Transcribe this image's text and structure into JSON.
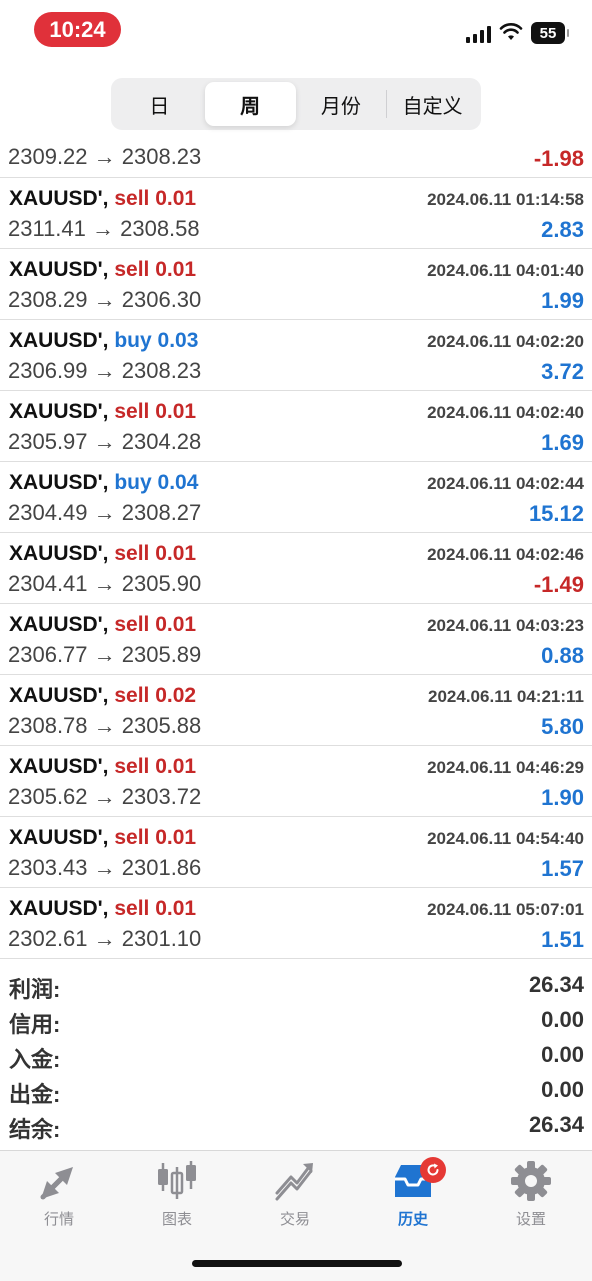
{
  "status": {
    "time": "10:24",
    "battery": "55"
  },
  "segments": [
    {
      "label": "日",
      "active": false
    },
    {
      "label": "周",
      "active": true
    },
    {
      "label": "月份",
      "active": false
    },
    {
      "label": "自定义",
      "active": false
    }
  ],
  "trades_partial": {
    "prices": "2309.22 → 2308.23",
    "profit": "-1.98"
  },
  "trades": [
    {
      "symbol": "XAUUSD'",
      "sep": ", ",
      "side": "sell 0.01",
      "datetime": "2024.06.11 01:14:58",
      "prices": "2311.41 → 2308.58",
      "profit": "2.83"
    },
    {
      "symbol": "XAUUSD'",
      "sep": ", ",
      "side": "sell 0.01",
      "datetime": "2024.06.11 04:01:40",
      "prices": "2308.29 → 2306.30",
      "profit": "1.99"
    },
    {
      "symbol": "XAUUSD'",
      "sep": ", ",
      "side": "buy 0.03",
      "datetime": "2024.06.11 04:02:20",
      "prices": "2306.99 → 2308.23",
      "profit": "3.72"
    },
    {
      "symbol": "XAUUSD'",
      "sep": ", ",
      "side": "sell 0.01",
      "datetime": "2024.06.11 04:02:40",
      "prices": "2305.97 → 2304.28",
      "profit": "1.69"
    },
    {
      "symbol": "XAUUSD'",
      "sep": ", ",
      "side": "buy 0.04",
      "datetime": "2024.06.11 04:02:44",
      "prices": "2304.49 → 2308.27",
      "profit": "15.12"
    },
    {
      "symbol": "XAUUSD'",
      "sep": ", ",
      "side": "sell 0.01",
      "datetime": "2024.06.11 04:02:46",
      "prices": "2304.41 → 2305.90",
      "profit": "-1.49"
    },
    {
      "symbol": "XAUUSD'",
      "sep": ", ",
      "side": "sell 0.01",
      "datetime": "2024.06.11 04:03:23",
      "prices": "2306.77 → 2305.89",
      "profit": "0.88"
    },
    {
      "symbol": "XAUUSD'",
      "sep": ", ",
      "side": "sell 0.02",
      "datetime": "2024.06.11 04:21:11",
      "prices": "2308.78 → 2305.88",
      "profit": "5.80"
    },
    {
      "symbol": "XAUUSD'",
      "sep": ", ",
      "side": "sell 0.01",
      "datetime": "2024.06.11 04:46:29",
      "prices": "2305.62 → 2303.72",
      "profit": "1.90"
    },
    {
      "symbol": "XAUUSD'",
      "sep": ", ",
      "side": "sell 0.01",
      "datetime": "2024.06.11 04:54:40",
      "prices": "2303.43 → 2301.86",
      "profit": "1.57"
    },
    {
      "symbol": "XAUUSD'",
      "sep": ", ",
      "side": "sell 0.01",
      "datetime": "2024.06.11 05:07:01",
      "prices": "2302.61 → 2301.10",
      "profit": "1.51"
    }
  ],
  "summary": [
    {
      "label": "利润:",
      "value": "26.34"
    },
    {
      "label": "信用:",
      "value": "0.00"
    },
    {
      "label": "入金:",
      "value": "0.00"
    },
    {
      "label": "出金:",
      "value": "0.00"
    },
    {
      "label": "结余:",
      "value": "26.34"
    }
  ],
  "tabs": [
    {
      "label": "行情",
      "icon": "quotes-arrows-icon",
      "active": false
    },
    {
      "label": "图表",
      "icon": "candlestick-chart-icon",
      "active": false
    },
    {
      "label": "交易",
      "icon": "trade-trend-icon",
      "active": false
    },
    {
      "label": "历史",
      "icon": "history-inbox-icon",
      "active": true
    },
    {
      "label": "设置",
      "icon": "gear-icon",
      "active": false
    }
  ],
  "colors": {
    "sell": "#c62828",
    "buy": "#1f74d1",
    "positive": "#1f74d1",
    "negative": "#c62828",
    "active_tab": "#1f74d1",
    "inactive_tab": "#8e8e93",
    "time_pill": "#e0313a"
  }
}
